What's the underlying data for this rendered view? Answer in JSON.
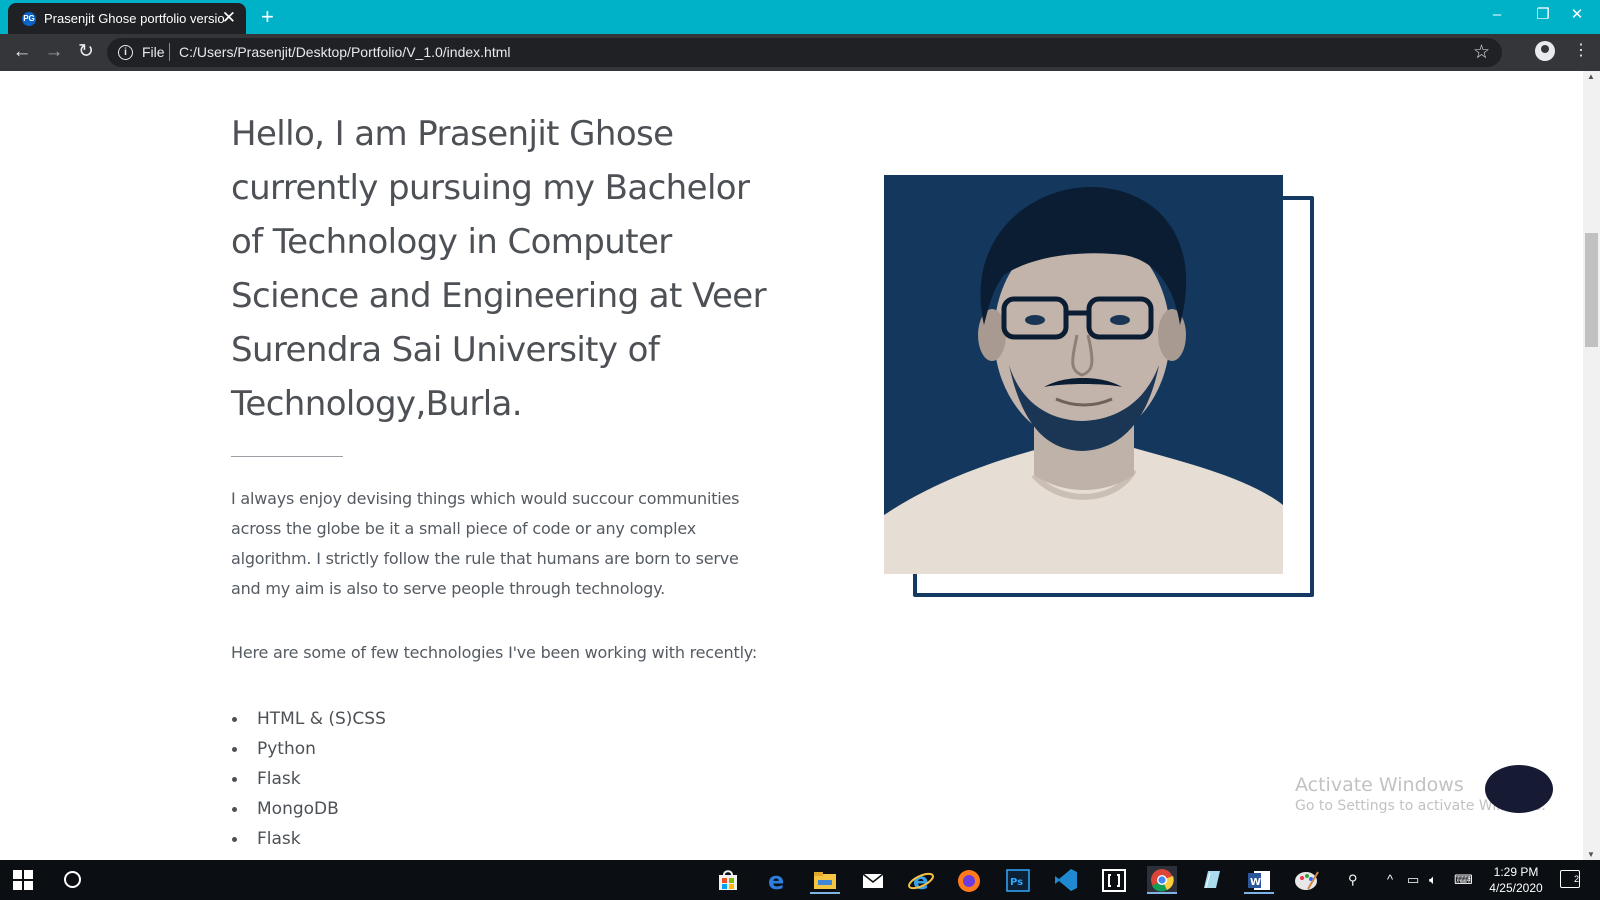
{
  "browser": {
    "tab_title": "Prasenjit Ghose portfolio version",
    "tab_favicon_text": "PG",
    "scheme_label": "File",
    "url": "C:/Users/Prasenjit/Desktop/Portfolio/V_1.0/index.html",
    "icons": [
      "back-icon",
      "forward-icon",
      "reload-icon",
      "info-icon",
      "star-icon",
      "profile-icon",
      "menu-icon",
      "minimize-icon",
      "restore-icon",
      "close-icon",
      "new-tab-icon"
    ]
  },
  "page": {
    "heading": "Hello, I am Prasenjit Ghose currently pursuing my Bachelor of Technology in Computer Science and Engineering at Veer Surendra Sai University of Technology,Burla.",
    "bio": "I always enjoy devising things which would succour communities across the globe be it a small piece of code or any complex algorithm. I strictly follow the rule that humans are born to serve and my aim is also to serve people through technology.",
    "tech_intro": "Here are some of few technologies I've been working with recently:",
    "technologies": [
      "HTML & (S)CSS",
      "Python",
      "Flask",
      "MongoDB",
      "Flask"
    ],
    "accent_color": "#143a63"
  },
  "watermark": {
    "line1": "Activate Windows",
    "line2": "Go to Settings to activate Windows."
  },
  "taskbar": {
    "time": "1:29 PM",
    "date": "4/25/2020",
    "notification_count": "2",
    "apps": [
      "store-icon",
      "edge-icon",
      "file-explorer-icon",
      "mail-icon",
      "internet-explorer-icon",
      "firefox-icon",
      "photoshop-icon",
      "vscode-icon",
      "brackets-icon",
      "chrome-icon",
      "notepad-icon",
      "word-icon",
      "paint-icon"
    ]
  }
}
